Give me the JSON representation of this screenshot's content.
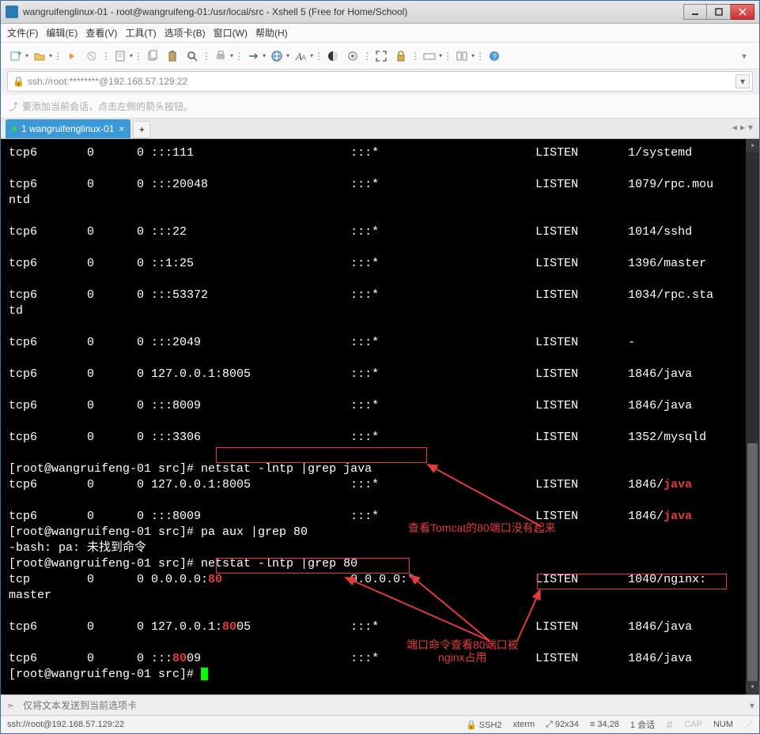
{
  "window": {
    "title": "wangruifenglinux-01 - root@wangruifeng-01:/usr/local/src - Xshell 5 (Free for Home/School)"
  },
  "menu": {
    "file": "文件(F)",
    "edit": "编辑(E)",
    "view": "查看(V)",
    "tools": "工具(T)",
    "tabs": "选项卡(B)",
    "window": "窗口(W)",
    "help": "帮助(H)"
  },
  "addressbar": {
    "text": "ssh://root:********@192.168.57.129:22"
  },
  "tipbar": {
    "text": "要添加当前会话，点击左侧的箭头按钮。"
  },
  "tab": {
    "label": "1 wangruifenglinux-01"
  },
  "sendbar": {
    "placeholder": "仅将文本发送到当前选项卡"
  },
  "statusbar": {
    "conn": "ssh://root@192.168.57.129:22",
    "proto": "SSH2",
    "term": "xterm",
    "size": "92x34",
    "cursor": "34,28",
    "sessions": "1 会话",
    "cap": "CAP",
    "num": "NUM"
  },
  "terminal": {
    "rows": [
      {
        "proto": "tcp6",
        "recv": "0",
        "send": "0",
        "local": ":::111",
        "foreign": ":::*",
        "state": "LISTEN",
        "pid": "1/systemd",
        "wrap": ""
      },
      {
        "proto": "tcp6",
        "recv": "0",
        "send": "0",
        "local": ":::20048",
        "foreign": ":::*",
        "state": "LISTEN",
        "pid": "1079/rpc.mou",
        "wrap": "ntd"
      },
      {
        "proto": "tcp6",
        "recv": "0",
        "send": "0",
        "local": ":::22",
        "foreign": ":::*",
        "state": "LISTEN",
        "pid": "1014/sshd",
        "wrap": ""
      },
      {
        "proto": "tcp6",
        "recv": "0",
        "send": "0",
        "local": "::1:25",
        "foreign": ":::*",
        "state": "LISTEN",
        "pid": "1396/master",
        "wrap": ""
      },
      {
        "proto": "tcp6",
        "recv": "0",
        "send": "0",
        "local": ":::53372",
        "foreign": ":::*",
        "state": "LISTEN",
        "pid": "1034/rpc.sta",
        "wrap": "td"
      },
      {
        "proto": "tcp6",
        "recv": "0",
        "send": "0",
        "local": ":::2049",
        "foreign": ":::*",
        "state": "LISTEN",
        "pid": "-",
        "wrap": ""
      },
      {
        "proto": "tcp6",
        "recv": "0",
        "send": "0",
        "local": "127.0.0.1:8005",
        "foreign": ":::*",
        "state": "LISTEN",
        "pid": "1846/java",
        "wrap": ""
      },
      {
        "proto": "tcp6",
        "recv": "0",
        "send": "0",
        "local": ":::8009",
        "foreign": ":::*",
        "state": "LISTEN",
        "pid": "1846/java",
        "wrap": ""
      },
      {
        "proto": "tcp6",
        "recv": "0",
        "send": "0",
        "local": ":::3306",
        "foreign": ":::*",
        "state": "LISTEN",
        "pid": "1352/mysqld",
        "wrap": ""
      }
    ],
    "prompt": "[root@wangruifeng-01 src]# ",
    "cmd1": "netstat -lntp |grep java",
    "grepjava": [
      {
        "proto": "tcp6",
        "recv": "0",
        "send": "0",
        "local": "127.0.0.1:8005",
        "foreign": ":::*",
        "state": "LISTEN",
        "pidpre": "1846/",
        "match": "java"
      },
      {
        "proto": "tcp6",
        "recv": "0",
        "send": "0",
        "local": ":::8009",
        "foreign": ":::*",
        "state": "LISTEN",
        "pidpre": "1846/",
        "match": "java"
      }
    ],
    "cmd2": "pa aux |grep 80",
    "err": "-bash: pa: 未找到命令",
    "cmd3": "netstat -lntp |grep 80",
    "grep80": [
      {
        "proto": "tcp",
        "recv": "0",
        "send": "0",
        "local_pre": "0.0.0.0:",
        "local_hi": "80",
        "local_post": "",
        "foreign": "0.0.0.0:*",
        "state": "LISTEN",
        "pid": "1040/nginx:",
        "wrap": "master"
      },
      {
        "proto": "tcp6",
        "recv": "0",
        "send": "0",
        "local_pre": "127.0.0.1:",
        "local_hi": "80",
        "local_post": "05",
        "foreign": ":::*",
        "state": "LISTEN",
        "pid": "1846/java",
        "wrap": ""
      },
      {
        "proto": "tcp6",
        "recv": "0",
        "send": "0",
        "local_pre": ":::",
        "local_hi": "80",
        "local_post": "09",
        "foreign": ":::*",
        "state": "LISTEN",
        "pid": "1846/java",
        "wrap": ""
      }
    ]
  },
  "annotations": {
    "a1": "查看Tomcat的80端口没有起来",
    "a2_l1": "端口命令查看80端口被",
    "a2_l2": "nginx占用"
  }
}
